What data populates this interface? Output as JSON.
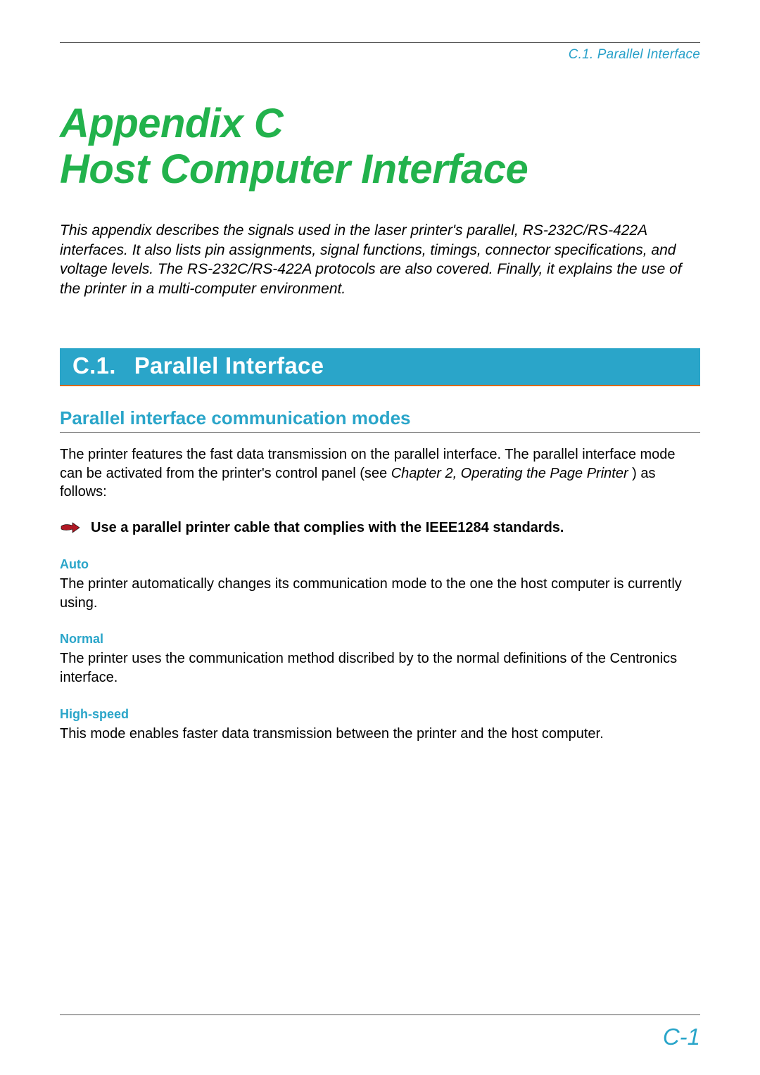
{
  "header": {
    "running_head": "C.1.  Parallel Interface"
  },
  "title": {
    "line1": "Appendix C",
    "line2": "Host Computer Interface"
  },
  "intro": "This appendix describes the signals used in the laser printer's parallel, RS-232C/RS-422A interfaces. It also lists pin assignments, signal functions, timings, connector specifications, and voltage levels. The RS-232C/RS-422A protocols are also covered. Finally, it explains the use of the printer in a multi-computer environment.",
  "section": {
    "number": "C.1.",
    "title": "Parallel Interface"
  },
  "subsection": "Parallel interface communication modes",
  "body": {
    "p1a": "The printer features the fast data transmission on the parallel interface. The parallel interface mode can be activated from the printer's control panel (see ",
    "p1_ital": "Chapter 2, Operating the Page Printer ",
    "p1b": ") as follows:"
  },
  "note": "Use a parallel printer cable that complies with the IEEE1284 standards.",
  "modes": {
    "auto": {
      "heading": "Auto",
      "text": "The printer automatically changes its communication mode to the one the host computer is currently using."
    },
    "normal": {
      "heading": "Normal",
      "text": "The printer uses the communication method discribed by to the normal definitions of the Centronics interface."
    },
    "high_speed": {
      "heading": "High-speed",
      "text": "This mode enables faster data transmission between the printer and the host computer."
    }
  },
  "page_number": "C-1"
}
